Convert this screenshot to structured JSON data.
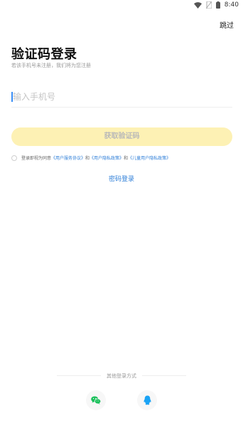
{
  "status_bar": {
    "time": "8:40"
  },
  "header": {
    "skip_label": "跳过"
  },
  "main": {
    "title": "验证码登录",
    "subtitle": "若该手机号未注册，我们将为您注册",
    "phone_placeholder": "输入手机号",
    "get_code_label": "获取验证码",
    "agreement": {
      "prefix": "登录即视为同意",
      "terms": "《用户服务协议》",
      "and1": "和",
      "privacy": "《用户隐私政策》",
      "and2": "和",
      "child_privacy": "《儿童用户隐私政策》"
    },
    "password_login_label": "密码登录"
  },
  "footer": {
    "other_methods_label": "其他登录方式",
    "methods": [
      {
        "icon": "wechat-icon",
        "color": "#19c05a"
      },
      {
        "icon": "qq-icon",
        "color": "#1aa3f5"
      }
    ]
  },
  "colors": {
    "accent_yellow": "#fdf1b4",
    "link_blue": "#2f7fd8"
  }
}
